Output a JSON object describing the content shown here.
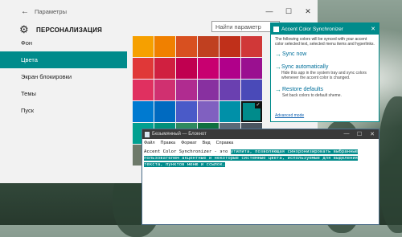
{
  "settings": {
    "window_title": "Параметры",
    "section_title": "ПЕРСОНАЛИЗАЦИЯ",
    "search_placeholder": "Найти параметр",
    "nav": [
      {
        "label": "Фон"
      },
      {
        "label": "Цвета"
      },
      {
        "label": "Экран блокировки"
      },
      {
        "label": "Темы"
      },
      {
        "label": "Пуск"
      }
    ],
    "selected_nav": "Цвета",
    "swatches": [
      "#f6a000",
      "#f08000",
      "#d85020",
      "#c04020",
      "#c0301a",
      "#d03838",
      "#e03838",
      "#d02040",
      "#c00050",
      "#c80070",
      "#b0008a",
      "#9a1090",
      "#e03060",
      "#d03070",
      "#b02c90",
      "#8830a0",
      "#6a40b0",
      "#4a4ab8",
      "#007ad0",
      "#006ac0",
      "#4a5ac8",
      "#8060c0",
      "#0090a8",
      "#008b8b",
      "#00a090",
      "#00907a",
      "#2f8a60",
      "#107040",
      "#5a6a78",
      "#4a5560",
      "#6e7a6a",
      "#5a6658",
      "#8a8a8a",
      "#5e6a72",
      "#4a4a4a",
      "#6a6a6a"
    ],
    "selected_swatch_index": 23,
    "accent": "#008b8b"
  },
  "acs": {
    "title": "Accent Color Synchronizer",
    "description": "The following colors will be synced with your accent color selected text, selected menu items and hyperlinks.",
    "actions": [
      {
        "title": "Sync now",
        "desc": ""
      },
      {
        "title": "Sync automatically",
        "desc": "Hide this app in the system tray and sync colors whenever the accent color is changed."
      },
      {
        "title": "Restore defaults",
        "desc": "Set back colors to default sheme."
      }
    ],
    "advanced_link": "Advanced mode"
  },
  "notepad": {
    "title": "Безымянный — Блокнот",
    "menu": [
      "Файл",
      "Правка",
      "Формат",
      "Вид",
      "Справка"
    ],
    "text_plain": "Accent Color Synchronizer - это ",
    "text_selected": "утилита, позволяющая синхронизировать выбранные пользователем акцентные и некоторые системные цвета, используемые для выделения текста, пунктов меню и ссылок."
  }
}
